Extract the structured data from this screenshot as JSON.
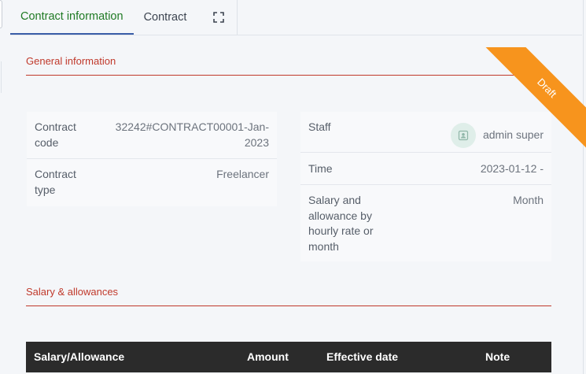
{
  "tabs": [
    {
      "label": "Contract information",
      "active": true
    },
    {
      "label": "Contract",
      "active": false
    }
  ],
  "tab_expand_icon": "fullscreen-icon",
  "sections": {
    "general": "General information",
    "salary": "Salary & allowances"
  },
  "ribbon": {
    "label": "Draft",
    "color": "#f7941d"
  },
  "left_card": {
    "contract_code_label": "Contract code",
    "contract_code_value": "32242#CONTRACT00001-Jan-2023",
    "contract_type_label": "Contract type",
    "contract_type_value": "Freelancer"
  },
  "right_card": {
    "staff_label": "Staff",
    "staff_value": "admin super",
    "staff_icon": "user-avatar-icon",
    "time_label": "Time",
    "time_value": "2023-01-12 -",
    "salary_label": "Salary and allowance by hourly rate or month",
    "salary_value": "Month"
  },
  "table": {
    "columns": [
      "Salary/Allowance",
      "Amount",
      "Effective date",
      "Note"
    ]
  },
  "colors": {
    "accent_green": "#1f7a24",
    "section_red": "#c0392b",
    "table_header": "#2b2b2b"
  }
}
